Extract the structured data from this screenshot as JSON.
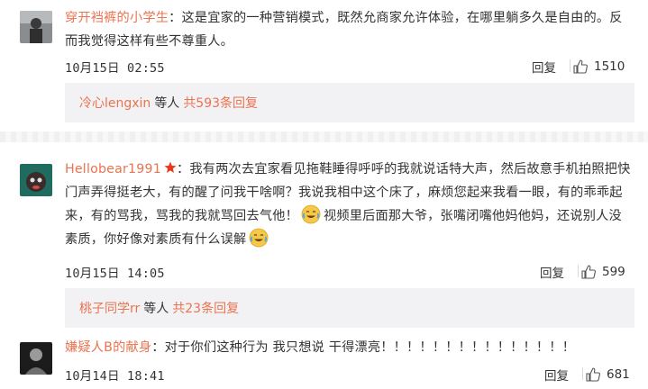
{
  "comments": [
    {
      "username": "穿开裆裤的小学生",
      "text": "：这是宜家的一种营销模式，既然允商家允许体验，在哪里躺多久是自由的。反而我觉得这样有些不尊重人。",
      "line1": "：这是宜家的一种营销模式，既然允商家允许体验，在哪里躺多久是自由的。反",
      "line2": "而我觉得这样有些不尊重人。",
      "timestamp": "10月15日 02:55",
      "reply_label": "回复",
      "likes": "1510",
      "reply_preview": {
        "user": "冷心lengxin",
        "middle": "等人",
        "count": "共593条回复"
      }
    },
    {
      "username": "Hellobear1991",
      "line1": "：我有两次去宜家看见拖鞋睡得呼呼的我就说话特大声，然后故意手机拍照把快",
      "line2": "门声弄得挺老大，有的醒了问我干啥啊？我说我相中这个床了，麻烦您起来我看一眼，有的乖乖起",
      "line3a": "来，有的骂我，骂我的我就骂回去气他！",
      "line3b": "视频里后面那大爷，张嘴闭嘴他妈他妈，还说别人没",
      "line4": "素质，你好像对素质有什么误解",
      "timestamp": "10月15日 14:05",
      "reply_label": "回复",
      "likes": "599",
      "reply_preview": {
        "user": "桃子同学rr",
        "middle": "等人",
        "count": "共23条回复"
      }
    },
    {
      "username": "嫌疑人B的献身",
      "text": "：对于你们这种行为 我只想说 干得漂亮！！！！！！！！！！！！！！！",
      "timestamp": "10月14日 18:41",
      "reply_label": "回复",
      "likes": "681"
    }
  ],
  "icons": {
    "like": "thumbs-up-icon",
    "badge": "star-badge-icon",
    "emoji": "laugh-cry-emoji-icon"
  },
  "colors": {
    "accent": "#eb7350",
    "reply_bg": "#f2f2f5",
    "text": "#333333"
  }
}
